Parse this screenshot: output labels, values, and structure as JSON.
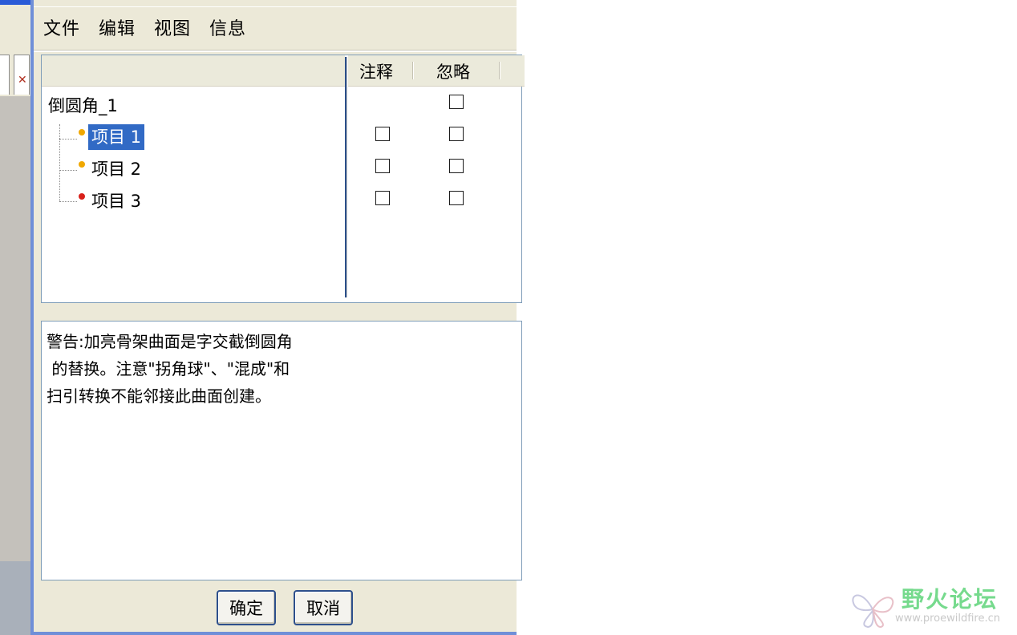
{
  "menu": {
    "file": "文件",
    "edit": "编辑",
    "view": "视图",
    "info": "信息"
  },
  "columns": {
    "annotate": "注释",
    "ignore": "忽略"
  },
  "tree": {
    "root": {
      "label": "倒圆角_1",
      "ignore_checked": false
    },
    "items": [
      {
        "label": "项目 1",
        "selected": true,
        "status_color": "#f0a800",
        "annotate_checked": false,
        "ignore_checked": false
      },
      {
        "label": "项目 2",
        "selected": false,
        "status_color": "#f0a800",
        "annotate_checked": false,
        "ignore_checked": false
      },
      {
        "label": "项目 3",
        "selected": false,
        "status_color": "#d8201a",
        "annotate_checked": false,
        "ignore_checked": false
      }
    ]
  },
  "message": "警告:加亮骨架曲面是字交截倒圆角\n 的替换。注意\"拐角球\"、\"混成\"和\n扫引转换不能邻接此曲面创建。",
  "buttons": {
    "ok": "确定",
    "cancel": "取消"
  },
  "watermark": {
    "title": "野火论坛",
    "url": "www.proewildfire.cn"
  },
  "colors": {
    "selection": "#316ac5",
    "dialog_bg": "#ece9d8",
    "frame_accent": "#6f8fd8"
  }
}
